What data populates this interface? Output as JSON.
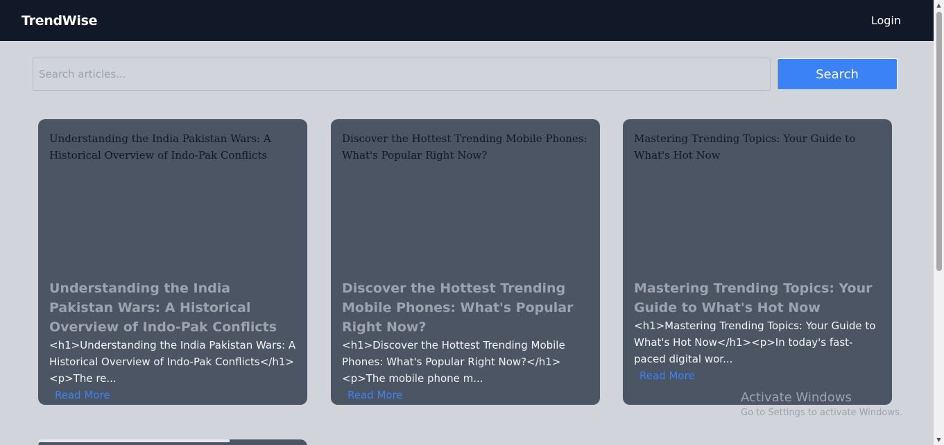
{
  "header": {
    "brand": "TrendWise",
    "login_label": "Login"
  },
  "search": {
    "placeholder": "Search articles...",
    "button_label": "Search"
  },
  "articles": [
    {
      "image_alt": "Understanding the India Pakistan Wars: A Historical Overview of Indo-Pak Conflicts",
      "title": "Understanding the India Pakistan Wars: A Historical Overview of Indo-Pak Conflicts",
      "excerpt": "<h1>Understanding the India Pakistan Wars: A Historical Overview of Indo-Pak Conflicts</h1><p>The re...",
      "read_more": "Read More"
    },
    {
      "image_alt": "Discover the Hottest Trending Mobile Phones: What's Popular Right Now?",
      "title": "Discover the Hottest Trending Mobile Phones: What's Popular Right Now?",
      "excerpt": "<h1>Discover the Hottest Trending Mobile Phones: What's Popular Right Now?</h1><p>The mobile phone m...",
      "read_more": "Read More"
    },
    {
      "image_alt": "Mastering Trending Topics: Your Guide to What's Hot Now",
      "title": "Mastering Trending Topics: Your Guide to What's Hot Now",
      "excerpt": "<h1>Mastering Trending Topics: Your Guide to What's Hot Now</h1><p>In today's fast-paced digital wor...",
      "read_more": "Read More"
    }
  ],
  "watermark": {
    "title": "Activate Windows",
    "subtitle": "Go to Settings to activate Windows."
  },
  "icons": {
    "scroll_up": "triangle-up",
    "scroll_down": "triangle-down"
  }
}
